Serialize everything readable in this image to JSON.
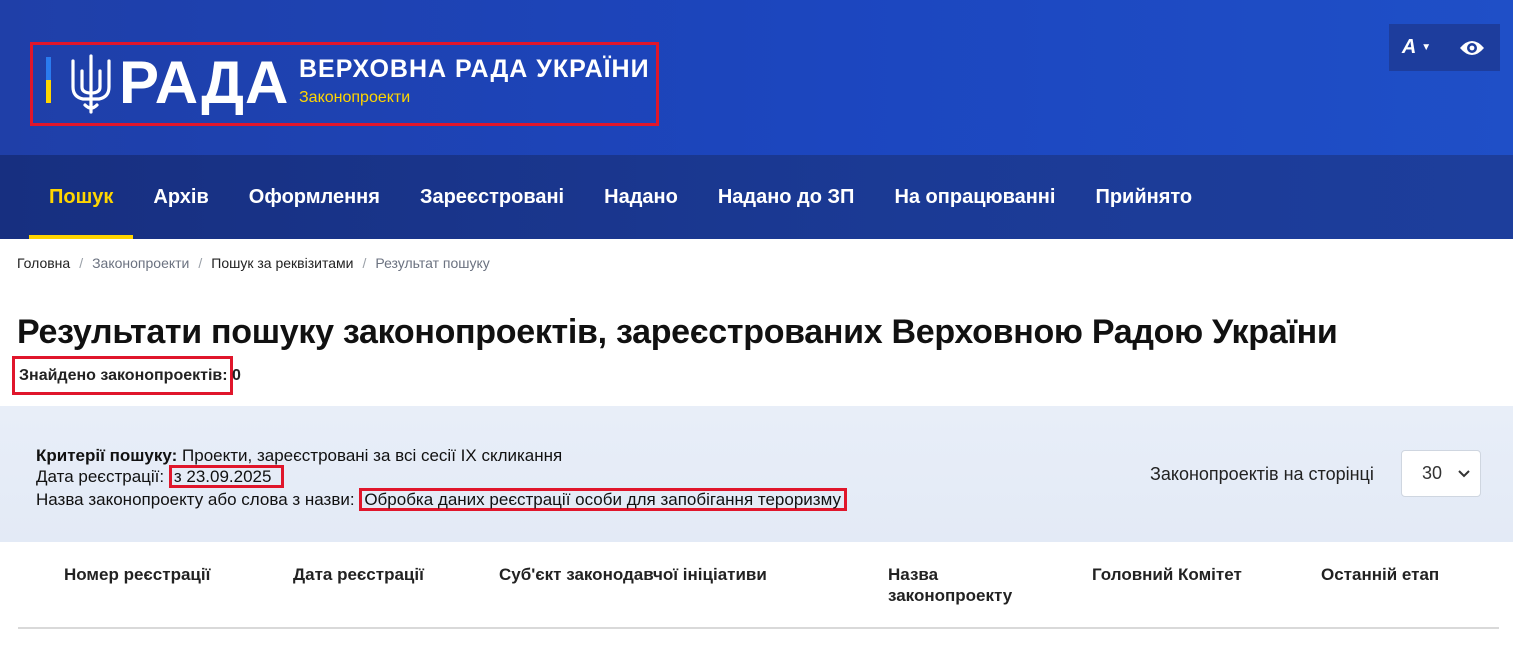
{
  "header": {
    "logo_word": "РАДА",
    "org_name": "ВЕРХОВНА РАДА УКРАЇНИ",
    "subtitle": "Законопроекти",
    "font_button": "A"
  },
  "nav": {
    "items": [
      {
        "label": "Пошук",
        "active": true
      },
      {
        "label": "Архів"
      },
      {
        "label": "Оформлення"
      },
      {
        "label": "Зареєстровані"
      },
      {
        "label": "Надано"
      },
      {
        "label": "Надано до ЗП"
      },
      {
        "label": "На опрацюванні"
      },
      {
        "label": "Прийнято"
      }
    ]
  },
  "breadcrumb": [
    "Головна",
    "Законопроекти",
    "Пошук за реквізитами",
    "Результат пошуку"
  ],
  "page": {
    "title": "Результати пошуку законопроектів, зареєстрованих Верховною Радою України",
    "found_label": "Знайдено законопроектів: 0"
  },
  "criteria": {
    "label": "Критерії пошуку:",
    "value": "Проекти, зареєстровані за всі сесії IX скликання",
    "date_label": "Дата реєстрації:",
    "date_value": "з 23.09.2025",
    "name_label": "Назва законопроекту або слова з назви:",
    "name_value": "Обробка даних реєстрації особи для запобігання тероризму"
  },
  "per_page": {
    "label": "Законопроектів на сторінці",
    "value": "30"
  },
  "table": {
    "headers": [
      "Номер реєстрації",
      "Дата реєстрації",
      "Суб'єкт законодавчої ініціативи",
      "Назва законопроекту",
      "Головний Комітет",
      "Останній етап"
    ]
  },
  "colors": {
    "highlight": "#e0162b",
    "accent": "#ffd500",
    "brand": "#1c46bf"
  }
}
